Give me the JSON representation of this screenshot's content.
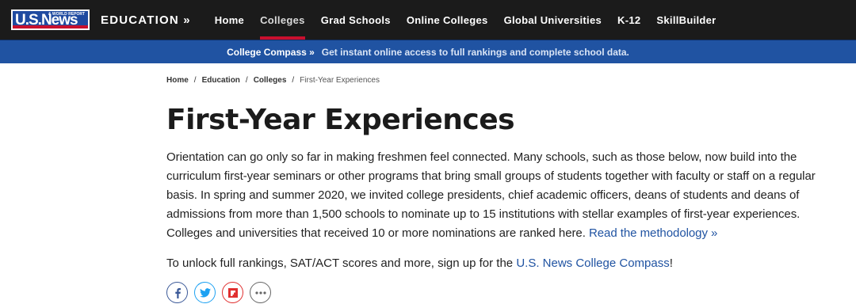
{
  "header": {
    "logo_text": "U.S.News",
    "logo_subtext": "& WORLD REPORT",
    "section": "EDUCATION »",
    "nav": [
      {
        "label": "Home",
        "active": false
      },
      {
        "label": "Colleges",
        "active": true
      },
      {
        "label": "Grad Schools",
        "active": false
      },
      {
        "label": "Online Colleges",
        "active": false
      },
      {
        "label": "Global Universities",
        "active": false
      },
      {
        "label": "K-12",
        "active": false
      },
      {
        "label": "SkillBuilder",
        "active": false
      }
    ]
  },
  "promo": {
    "label": "College Compass »",
    "text": "Get instant online access to full rankings and complete school data."
  },
  "breadcrumb": [
    "Home",
    "Education",
    "Colleges",
    "First-Year Experiences"
  ],
  "breadcrumb_separator": "/",
  "page": {
    "title": "First-Year Experiences",
    "intro": "Orientation can go only so far in making freshmen feel connected. Many schools, such as those below, now build into the curriculum first-year seminars or other programs that bring small groups of students together with faculty or staff on a regular basis. In spring and summer 2020, we invited college presidents, chief academic officers, deans of students and deans of admissions from more than 1,500 schools to nominate up to 15 institutions with stellar examples of first-year experiences. Colleges and universities that received 10 or more nominations are ranked here.",
    "methodology_link": "Read the methodology »",
    "unlock_prefix": "To unlock full rankings, SAT/ACT scores and more, sign up for the",
    "unlock_link": "U.S. News College Compass",
    "unlock_suffix": "!"
  },
  "social": [
    {
      "name": "facebook-icon",
      "color": "#3b5998"
    },
    {
      "name": "twitter-icon",
      "color": "#1da1f2"
    },
    {
      "name": "flipboard-icon",
      "color": "#e02f2f"
    },
    {
      "name": "more-icon",
      "color": "#666666"
    }
  ]
}
